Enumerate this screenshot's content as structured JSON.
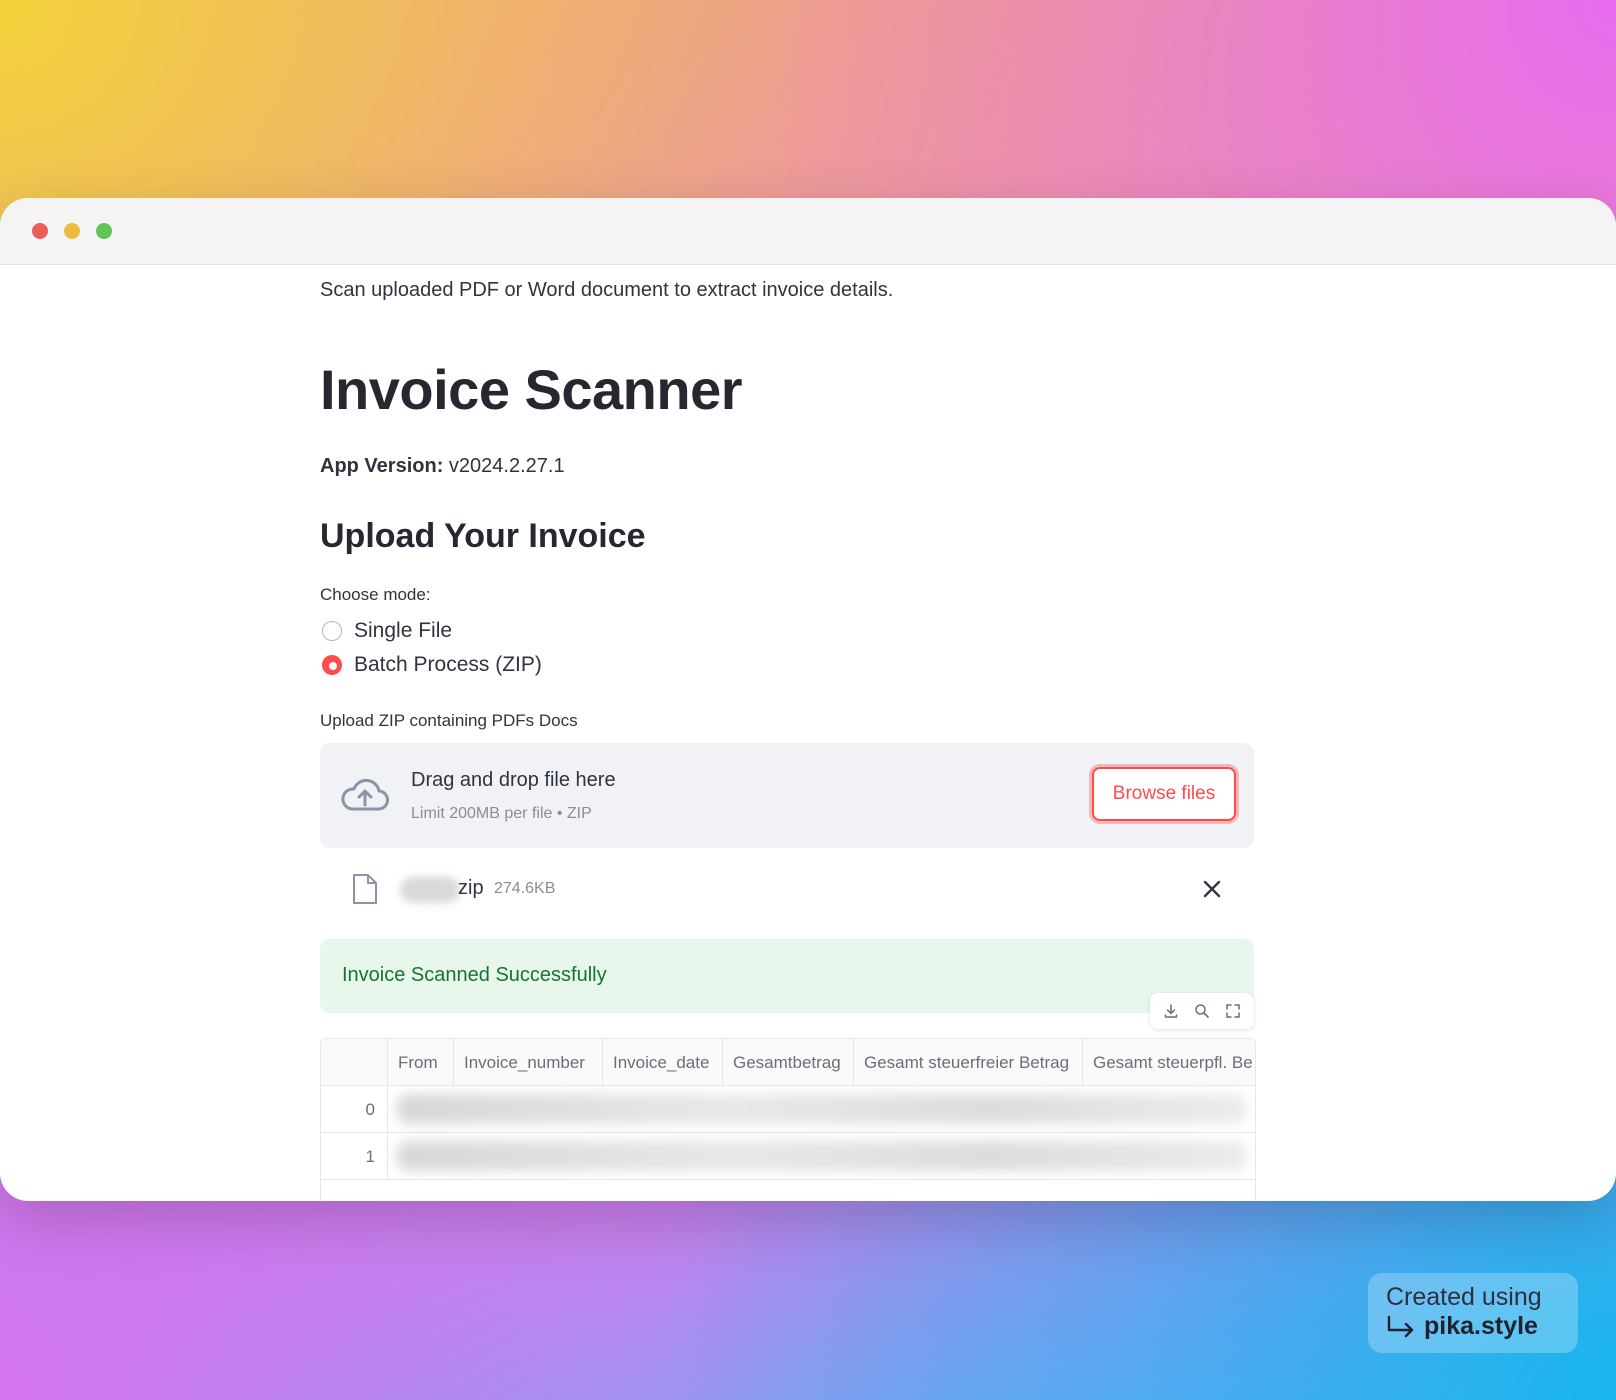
{
  "page": {
    "subtitle": "Scan uploaded PDF or Word document to extract invoice details.",
    "title": "Invoice Scanner",
    "version_label": "App Version:",
    "version_value": "v2024.2.27.1",
    "section_title": "Upload Your Invoice"
  },
  "mode": {
    "label": "Choose mode:",
    "options": [
      {
        "label": "Single File",
        "checked": false
      },
      {
        "label": "Batch Process (ZIP)",
        "checked": true
      }
    ]
  },
  "uploader": {
    "label": "Upload ZIP containing PDFs Docs",
    "drop_text": "Drag and drop file here",
    "limit_text": "Limit 200MB per file • ZIP",
    "browse_label": "Browse files",
    "icon": "cloud-upload-icon"
  },
  "uploaded_file": {
    "name": "zip",
    "size": "274.6KB",
    "icon": "file-icon"
  },
  "status": {
    "success_message": "Invoice Scanned Successfully"
  },
  "table": {
    "toolbar": [
      "download-icon",
      "search-icon",
      "fullscreen-icon"
    ],
    "columns": [
      "From",
      "Invoice_number",
      "Invoice_date",
      "Gesamtbetrag",
      "Gesamt steuerfreier Betrag",
      "Gesamt steuerpfl. Be"
    ],
    "rows": [
      {
        "index": "0"
      },
      {
        "index": "1"
      }
    ]
  },
  "watermark": {
    "line1": "Created using",
    "line2": "pika.style"
  },
  "colors": {
    "accent": "#ff4b4b",
    "success_bg": "#e8f7ec",
    "success_text": "#177233",
    "dropzone_bg": "#f0f2f6"
  }
}
